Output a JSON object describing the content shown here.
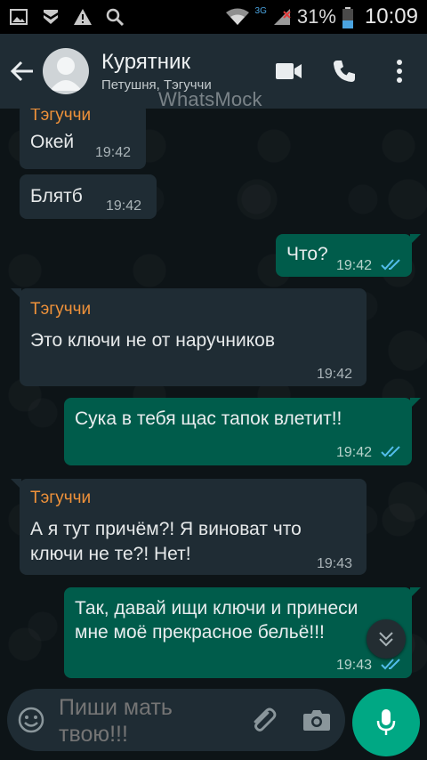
{
  "status_bar": {
    "network_tag": "3G",
    "battery_percent": "31%",
    "clock": "10:09"
  },
  "header": {
    "title": "Курятник",
    "subtitle": "Петушня, Тэгуччи",
    "watermark": "WhatsMock"
  },
  "messages": [
    {
      "direction": "in",
      "sender": "Тэгуччи",
      "text": "Окей",
      "time": "19:42"
    },
    {
      "direction": "in",
      "sender": "",
      "text": "Блятб",
      "time": "19:42"
    },
    {
      "direction": "out",
      "text": "Что?",
      "time": "19:42",
      "status": "read"
    },
    {
      "direction": "in",
      "sender": "Тэгуччи",
      "text": "Это ключи не от наручников",
      "time": "19:42"
    },
    {
      "direction": "out",
      "text": "Сука в тебя щас тапок влетит!!",
      "time": "19:42",
      "status": "read"
    },
    {
      "direction": "in",
      "sender": "Тэгуччи",
      "text_lines": [
        "А я тут причём?! Я виноват что",
        "ключи не те?! Нет!"
      ],
      "time": "19:43"
    },
    {
      "direction": "out",
      "text_lines": [
        "Так, давай ищи ключи и принеси",
        "мне моё прекрасное бельё!!!"
      ],
      "time": "19:43",
      "status": "read"
    }
  ],
  "composer": {
    "placeholder": "Пиши мать твою!!!"
  },
  "colors": {
    "header_bg": "#1f2c34",
    "incoming_bubble": "#1f2c34",
    "outgoing_bubble": "#005c4b",
    "sender_name": "#f0923a",
    "read_tick": "#53bdeb",
    "mic_button": "#00a884"
  },
  "icons": {
    "back": "arrow-left-icon",
    "video": "video-camera-icon",
    "call": "phone-icon",
    "menu": "more-vertical-icon",
    "emoji": "emoji-icon",
    "attach": "paperclip-icon",
    "camera": "camera-icon",
    "mic": "microphone-icon",
    "scroll": "double-chevron-down-icon"
  }
}
